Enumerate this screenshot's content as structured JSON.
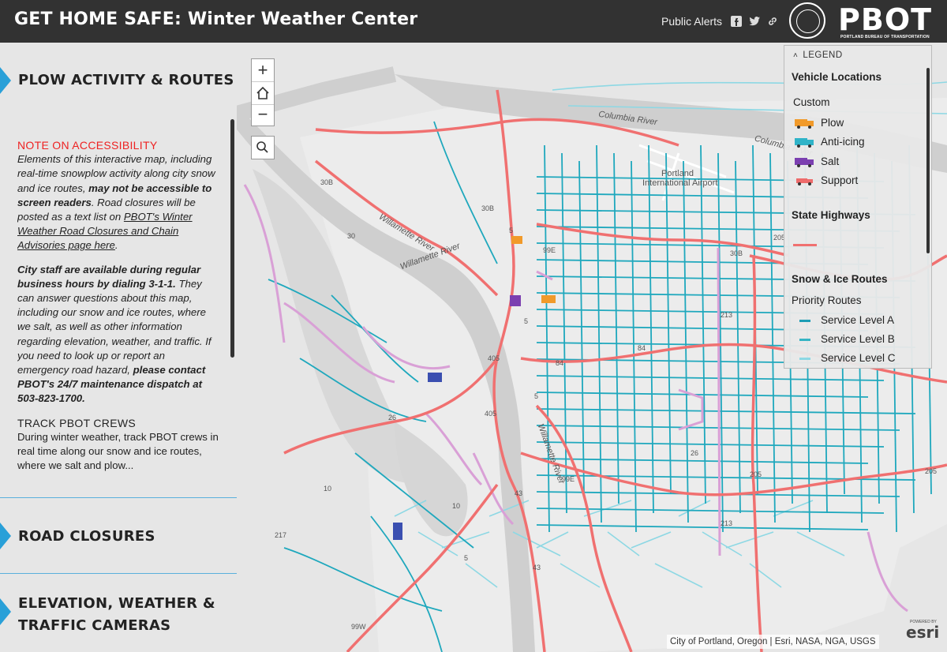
{
  "header": {
    "title": "GET HOME SAFE: Winter Weather Center",
    "public_alerts": "Public Alerts",
    "logo": "PBOT",
    "logo_sub": "PORTLAND BUREAU OF TRANSPORTATION",
    "social_icons": [
      "facebook-icon",
      "twitter-icon",
      "link-icon"
    ]
  },
  "sidebar": {
    "sections": [
      {
        "label": "PLOW ACTIVITY & ROUTES",
        "expanded": true
      },
      {
        "label": "ROAD CLOSURES",
        "expanded": false
      },
      {
        "label_line1": "ELEVATION, WEATHER &",
        "label_line2": "TRAFFIC CAMERAS",
        "expanded": false
      }
    ],
    "note_heading": "NOTE ON ACCESSIBILITY",
    "note_part1": "Elements of this interactive map, including real-time snowplow activity along city snow and ice routes, ",
    "note_bold": "may not be accessible to screen readers",
    "note_part2": ". Road closures will be posted as a text list on ",
    "note_link": "PBOT's Winter Weather Road Closures and Chain Advisories page here",
    "note_part3": ".",
    "staff_bold": "City staff are available during regular business hours by dialing 3-1-1.",
    "staff_text": " They can answer questions about this map, including our snow and ice routes, where we salt, as well as other information regarding elevation, weather, and traffic. If you need to look up or report an emergency road hazard, ",
    "staff_bold2": "please contact PBOT's 24/7 maintenance dispatch at 503-823-1700.",
    "track_heading": "TRACK PBOT CREWS",
    "track_text": "During winter weather, track PBOT crews in real time along our snow and ice routes, where we salt and plow..."
  },
  "map": {
    "zoom_in": "+",
    "zoom_out": "−",
    "labels": {
      "columbia": "Columbia River",
      "columbia2": "Columbia River",
      "airport": "Portland",
      "airport2": "International Airport",
      "willamette": "Willamette River",
      "willamette2": "Willamette River",
      "willamette3": "Willamette River",
      "r30b_1": "30B",
      "r30b_2": "30B",
      "r30b_3": "30B",
      "r30": "30",
      "r5a": "5",
      "r5b": "5",
      "r5c": "5",
      "r5d": "5",
      "r99e": "99E",
      "r99e2": "99E",
      "r84": "84",
      "r84b": "84",
      "r405": "405",
      "r405b": "405",
      "r26": "26",
      "r26b": "26",
      "r213": "213",
      "r213b": "213",
      "r205": "205",
      "r205b": "205",
      "r205c": "205",
      "r43": "43",
      "r43b": "43",
      "r10": "10",
      "r10b": "10",
      "r217": "217",
      "r99w": "99W"
    },
    "attribution": "City of Portland, Oregon | Esri, NASA, NGA, USGS",
    "esri": "esri",
    "esri_powered": "POWERED BY"
  },
  "legend": {
    "heading": "LEGEND",
    "vehicle_locations": "Vehicle Locations",
    "custom": "Custom",
    "vehicles": [
      {
        "label": "Plow",
        "color": "#f19a2a"
      },
      {
        "label": "Anti-icing",
        "color": "#2fb3c8"
      },
      {
        "label": "Salt",
        "color": "#7b3fb0"
      },
      {
        "label": "Support",
        "color": "#ee6b6b"
      }
    ],
    "state_highways": "State Highways",
    "highway_color": "#f07070",
    "snow_ice_routes": "Snow & Ice Routes",
    "priority_routes": "Priority Routes",
    "levels": [
      {
        "label": "Service Level A",
        "color": "#1d9db5"
      },
      {
        "label": "Service Level B",
        "color": "#34b4c4"
      },
      {
        "label": "Service Level C",
        "color": "#8dd8e4"
      }
    ]
  }
}
